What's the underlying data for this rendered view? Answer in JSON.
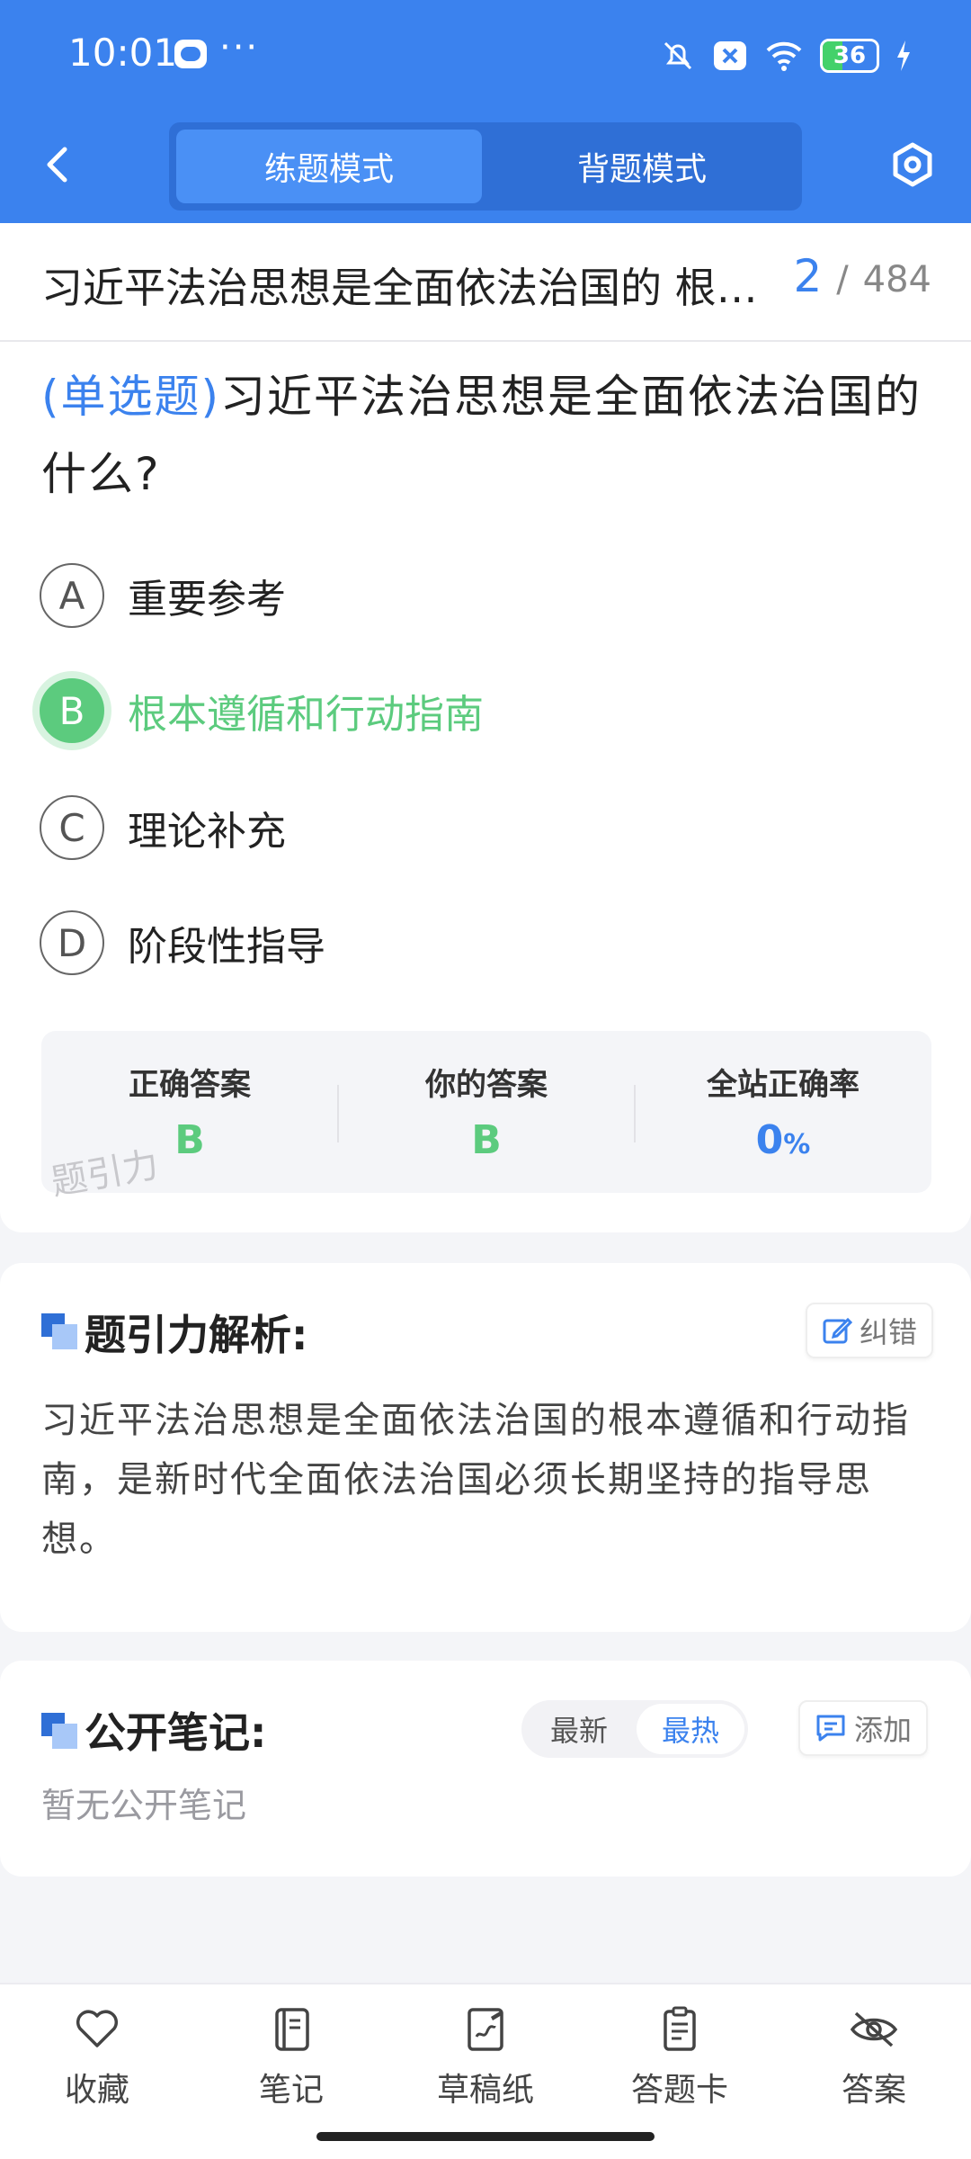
{
  "status_bar": {
    "time": "10:01",
    "more": "···",
    "battery": "36",
    "battery_level": 0.36
  },
  "nav": {
    "tabs": [
      "练题模式",
      "背题模式"
    ],
    "active_tab": 0
  },
  "question_header": {
    "title": "习近平法治思想是全面依法治国的 根本遵循和行动指南",
    "current": "2",
    "separator": "/",
    "total": "484"
  },
  "question": {
    "type": "(单选题)",
    "text": "习近平法治思想是全面依法治国的什么?",
    "options": [
      {
        "letter": "A",
        "text": "重要参考"
      },
      {
        "letter": "B",
        "text": "根本遵循和行动指南"
      },
      {
        "letter": "C",
        "text": "理论补充"
      },
      {
        "letter": "D",
        "text": "阶段性指导"
      }
    ]
  },
  "stats": {
    "correct_label": "正确答案",
    "correct_value": "B",
    "yours_label": "你的答案",
    "yours_value": "B",
    "rate_label": "全站正确率",
    "rate_value": "0",
    "rate_unit": "%",
    "watermark": "题引力"
  },
  "analysis": {
    "title": "题引力解析:",
    "report_label": "纠错",
    "text": "习近平法治思想是全面依法治国的根本遵循和行动指南，是新时代全面依法治国必须长期坚持的指导思想。"
  },
  "notes": {
    "title": "公开笔记:",
    "sort_latest": "最新",
    "sort_hot": "最热",
    "add_label": "添加",
    "empty_text": "暂无公开笔记"
  },
  "bottom_bar": {
    "favorite": "收藏",
    "notes": "笔记",
    "draft": "草稿纸",
    "answer_card": "答题卡",
    "answer": "答案"
  },
  "colors": {
    "primary": "#3b82ee",
    "correct": "#5ccb7e"
  }
}
